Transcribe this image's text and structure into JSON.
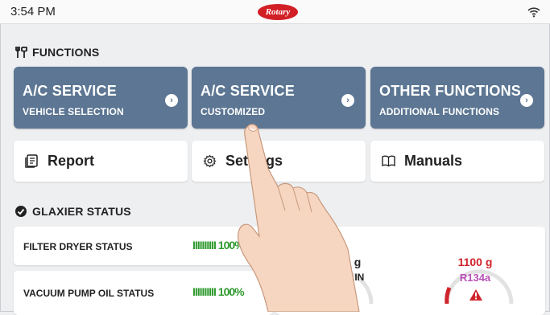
{
  "status_bar": {
    "time": "3:54 PM",
    "logo_text": "Rotary"
  },
  "functions_header": "FUNCTIONS",
  "tiles": [
    {
      "title": "A/C SERVICE",
      "subtitle": "VEHICLE SELECTION"
    },
    {
      "title": "A/C SERVICE",
      "subtitle": "CUSTOMIZED"
    },
    {
      "title": "OTHER FUNCTIONS",
      "subtitle": "ADDITIONAL FUNCTIONS"
    }
  ],
  "buttons": [
    {
      "label": "Report",
      "icon": "report-icon"
    },
    {
      "label": "Settings",
      "icon": "gear-icon"
    },
    {
      "label": "Manuals",
      "icon": "book-icon"
    }
  ],
  "status_header": "GLAXIER STATUS",
  "status_rows": [
    {
      "label": "FILTER DRYER STATUS",
      "bar": "IIIIIIIIII",
      "value": "100%",
      "level": 1.0
    },
    {
      "label": "VACUUM PUMP OIL STATUS",
      "bar": "IIIIIIIIII",
      "value": "100%",
      "level": 1.0
    }
  ],
  "gauges": [
    {
      "value_text": "g",
      "sub_text": "AIN"
    },
    {
      "value_text": "1100 g",
      "sub_text": "R134a",
      "warning_icon": "warning-icon"
    }
  ],
  "colors": {
    "tile_bg": "#5c7693",
    "status_green": "#2e9a2e",
    "gauge_red": "#d0242c",
    "gauge_purple": "#b94fb6",
    "logo_red": "#d21f26"
  }
}
